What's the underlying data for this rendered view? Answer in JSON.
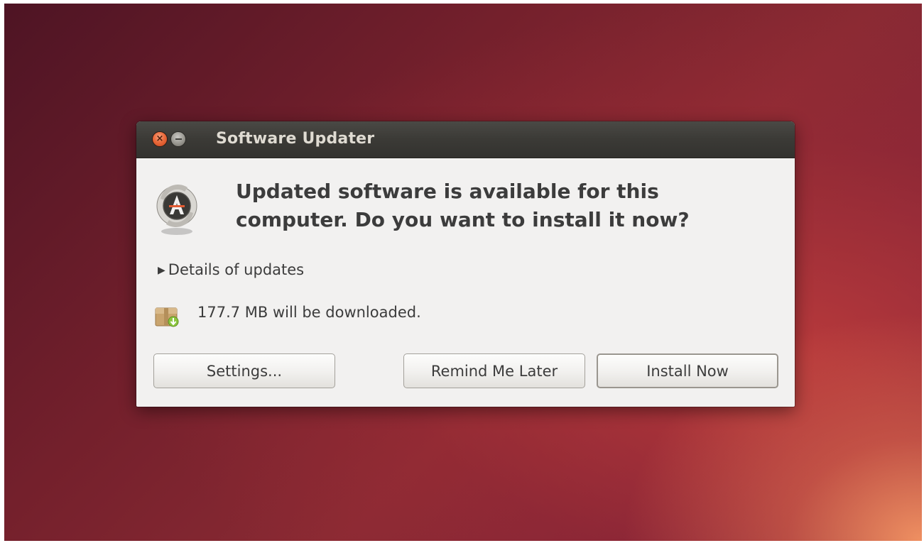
{
  "window": {
    "title": "Software Updater"
  },
  "dialog": {
    "headline": "Updated software is available for this computer. Do you want to install it now?",
    "details_label": "Details of updates",
    "details_arrow": "▶",
    "download_text": "177.7 MB will be downloaded.",
    "icons": {
      "close": "close-icon",
      "minimize": "minimize-icon",
      "app": "software-updater-icon",
      "package": "package-icon"
    }
  },
  "buttons": {
    "settings": "Settings...",
    "remind": "Remind Me Later",
    "install": "Install Now"
  },
  "colors": {
    "close_button": "#ea6a3b",
    "titlebar": "#3b3a36",
    "dialog_bg": "#f2f1f0"
  }
}
